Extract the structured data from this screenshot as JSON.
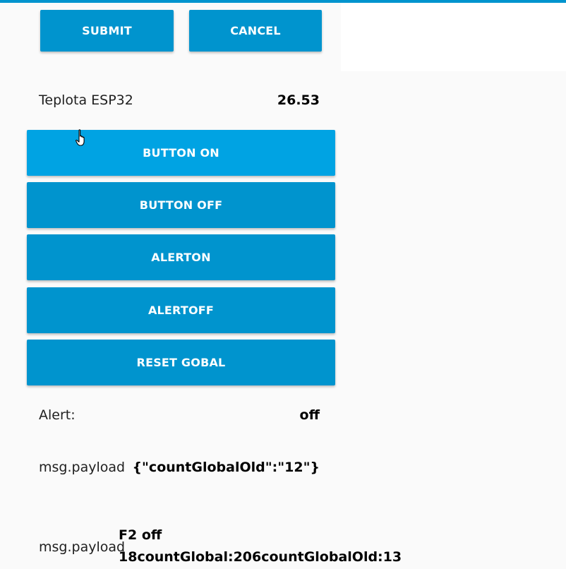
{
  "form": {
    "submit_label": "SUBMIT",
    "cancel_label": "CANCEL"
  },
  "sensor": {
    "label": "Teplota ESP32",
    "value": "26.53"
  },
  "buttons": [
    {
      "label": "BUTTON ON"
    },
    {
      "label": "BUTTON OFF"
    },
    {
      "label": "ALERTON"
    },
    {
      "label": "ALERTOFF"
    },
    {
      "label": "RESET GOBAL"
    }
  ],
  "alert": {
    "label": "Alert:",
    "value": "off"
  },
  "payload1": {
    "label": "msg.payload",
    "value": "{\"countGlobalOld\":\"12\"}"
  },
  "payload2": {
    "label": "msg.payload",
    "line1": "F2 off",
    "line2": "18countGlobal:206countGlobalOld:13"
  },
  "theme": {
    "accent": "#0094ce",
    "accent_hover": "#00a3e3"
  }
}
